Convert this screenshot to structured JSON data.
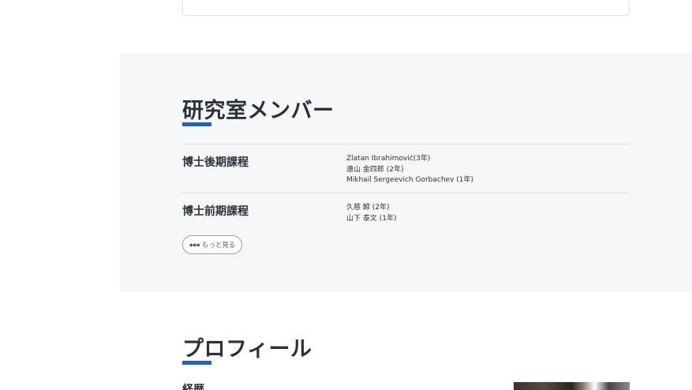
{
  "members": {
    "title": "研究室メンバー",
    "courses": [
      {
        "label": "博士後期課程",
        "students": [
          "Zlatan Ibrahimović(3年)",
          "遠山 金四郎 (2年)",
          "Mikhail Sergeevich Gorbachev (1年)"
        ]
      },
      {
        "label": "博士前期課程",
        "students": [
          "久慈 鯨 (2年)",
          "山下 泰文 (1年)"
        ]
      }
    ],
    "more_label": "もっと見る",
    "more_icon": "ellipsis-icon"
  },
  "profile": {
    "title": "プロフィール",
    "history_label": "経歴"
  },
  "colors": {
    "accent": "#1f61c7",
    "section_bg": "#f6f7f9",
    "text": "#2b313b",
    "rule": "#dcdfe4"
  }
}
